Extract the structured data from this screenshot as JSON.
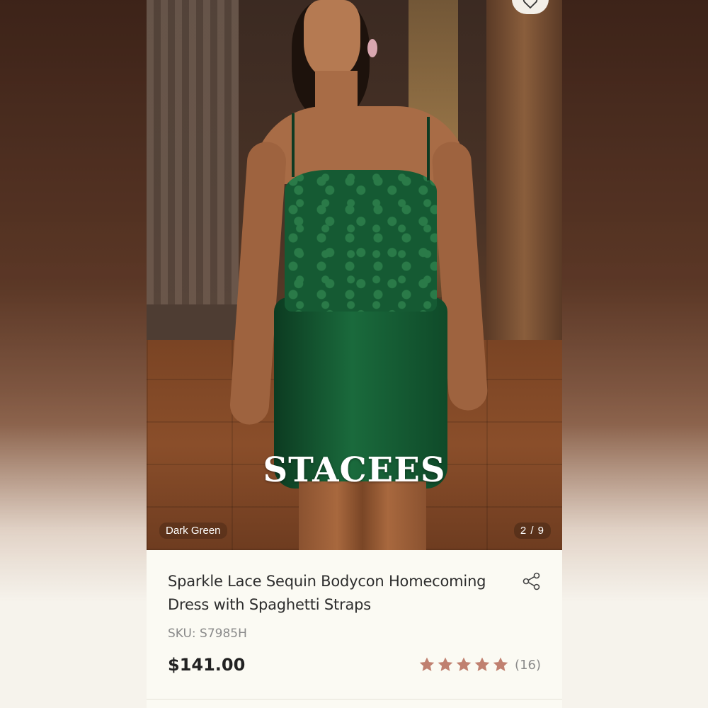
{
  "product": {
    "brand_watermark": "STACEES",
    "color_label": "Dark Green",
    "image_counter": "2 / 9",
    "title": "Sparkle Lace Sequin Bodycon Homecoming Dress with Spaghetti Straps",
    "sku": "SKU: S7985H",
    "price": "$141.00",
    "rating": {
      "stars": 5,
      "max_stars": 5,
      "review_count": "(16)"
    }
  },
  "icons": {
    "favorite": "heart-icon",
    "share": "share-icon",
    "star": "star-icon"
  },
  "colors": {
    "star": "#c08070",
    "text_primary": "#2d2d2d",
    "text_secondary": "#8a8a8a",
    "card_background": "#fbfaf3"
  }
}
